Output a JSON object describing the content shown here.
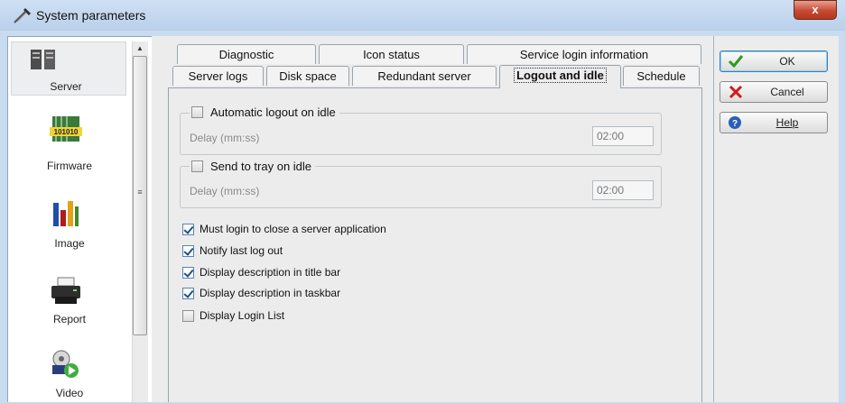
{
  "window": {
    "title": "System parameters",
    "close_label": "x"
  },
  "nav": {
    "items": [
      {
        "label": "Server",
        "icon": "server-icon"
      },
      {
        "label": "Firmware",
        "icon": "firmware-icon"
      },
      {
        "label": "Image",
        "icon": "image-icon"
      },
      {
        "label": "Report",
        "icon": "printer-icon"
      },
      {
        "label": "Video",
        "icon": "video-icon"
      }
    ],
    "firmware_icon_text": "101010",
    "scroll_grip": "≡",
    "scroll_up": "▲"
  },
  "tabs": {
    "row1": [
      "Diagnostic",
      "Icon status",
      "Service login information"
    ],
    "row2": [
      "Server logs",
      "Disk space",
      "Redundant server",
      "Logout and idle",
      "Schedule"
    ],
    "active": "Logout and idle"
  },
  "logout_idle": {
    "auto_logout": {
      "label": "Automatic logout on idle",
      "checked": false,
      "delay_label": "Delay (mm:ss)",
      "delay_value": "02:00"
    },
    "send_to_tray": {
      "label": "Send to tray on idle",
      "checked": false,
      "delay_label": "Delay (mm:ss)",
      "delay_value": "02:00"
    },
    "options": [
      {
        "label": "Must login to close a server application",
        "checked": true
      },
      {
        "label": "Notify last log out",
        "checked": true
      },
      {
        "label": "Display description in title bar",
        "checked": true
      },
      {
        "label": "Display description in taskbar",
        "checked": true
      },
      {
        "label": "Display Login List",
        "checked": false
      }
    ]
  },
  "buttons": {
    "ok": "OK",
    "cancel": "Cancel",
    "help": "Help"
  },
  "colors": {
    "ok_check": "#2e9a1e",
    "cancel_x": "#d11a1a",
    "help_icon": "#2a5fb8",
    "close_button": "#c64a33"
  }
}
